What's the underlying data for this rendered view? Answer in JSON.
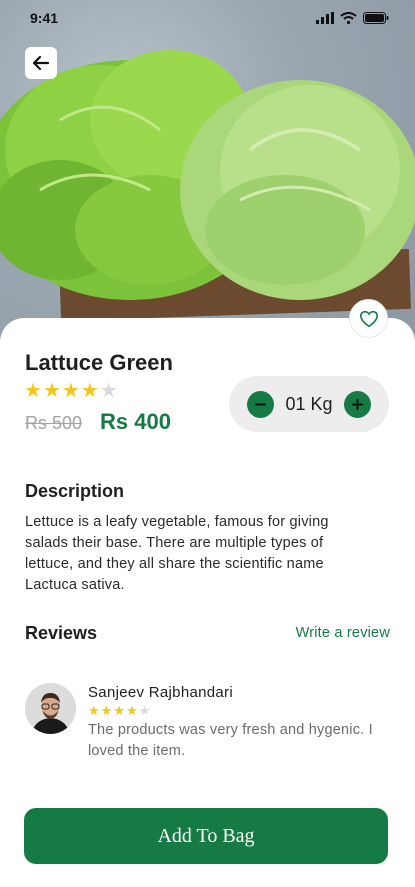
{
  "status_bar": {
    "time": "9:41"
  },
  "product": {
    "name": "Lattuce Green",
    "rating": 4,
    "rating_max": 5,
    "old_price": "Rs 500",
    "new_price": "Rs 400",
    "quantity": "01 Kg"
  },
  "description": {
    "heading": "Description",
    "text": "Lettuce is a leafy vegetable, famous for giving salads their base. There are multiple types of lettuce, and they all share the scientific name Lactuca sativa."
  },
  "reviews": {
    "heading": "Reviews",
    "write_label": "Write a review",
    "items": [
      {
        "name": "Sanjeev Rajbhandari",
        "rating": 4,
        "rating_max": 5,
        "text": "The products was very fresh and hygenic. I loved the item."
      }
    ]
  },
  "cta": {
    "label": "Add To Bag"
  },
  "colors": {
    "brand_green": "#157a43",
    "star_filled": "#f5c518",
    "star_empty": "#d9d9d9"
  },
  "icons": [
    "back-arrow-icon",
    "heart-icon",
    "minus-icon",
    "plus-icon",
    "signal-icon",
    "wifi-icon",
    "battery-icon",
    "star-icon"
  ]
}
